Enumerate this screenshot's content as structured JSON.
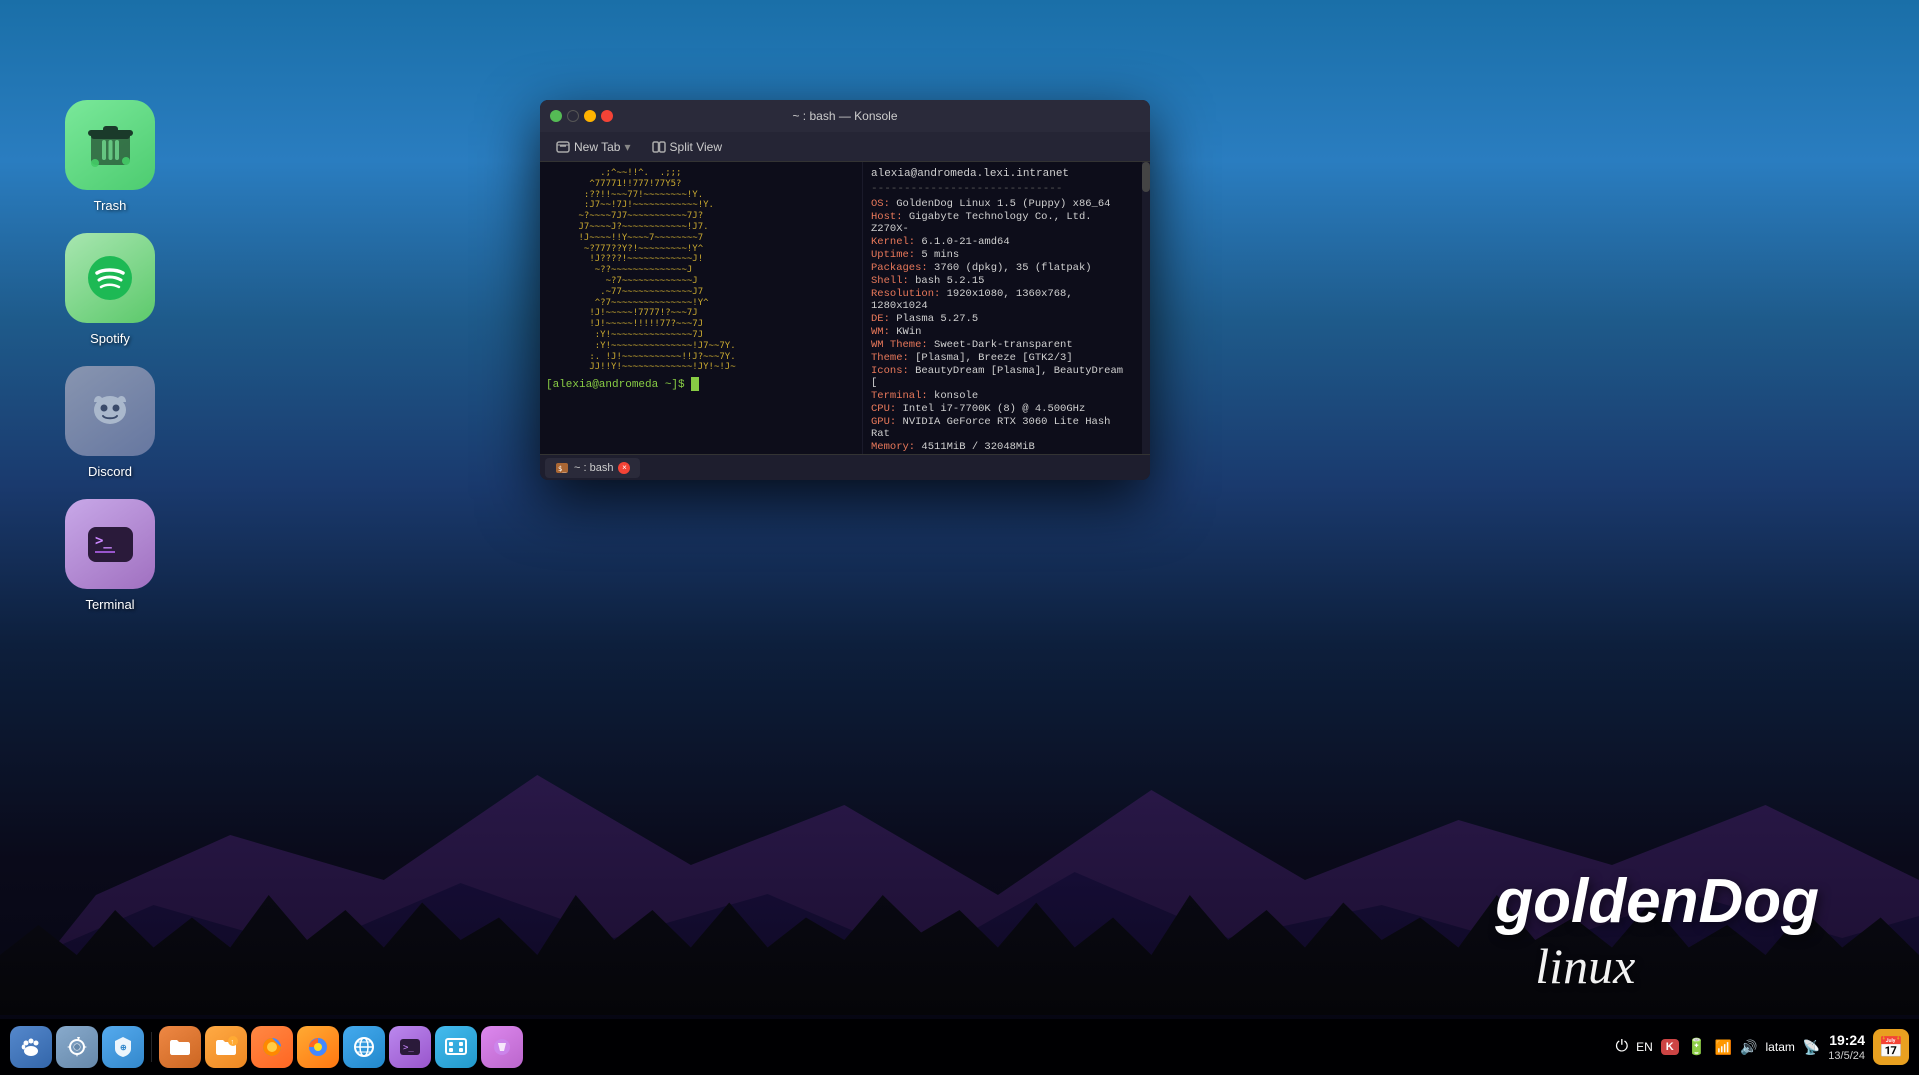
{
  "desktop": {
    "background": "KDE Plasma desktop - GoldenDog Linux",
    "icons": [
      {
        "id": "trash",
        "label": "Trash",
        "color": "#4dcc70"
      },
      {
        "id": "spotify",
        "label": "Spotify",
        "color": "#5cc96b"
      },
      {
        "id": "discord",
        "label": "Discord",
        "color": "#8895b0"
      },
      {
        "id": "terminal",
        "label": "Terminal",
        "color": "#a070c0"
      }
    ]
  },
  "logo": {
    "line1": "goldenDog",
    "line2": "linux"
  },
  "konsole": {
    "title": "~ : bash — Konsole",
    "toolbar": {
      "new_tab": "New Tab",
      "split_view": "Split View"
    },
    "ascii_art": "          .;^~~!!^.  .;;;\n        ^77771!!777!77Y5?\n       :??!!~~~77!~~~~~~~~!Y.\n       :J7~~!7J!~~~~~~~~~~~~!Y.\n      ~?~~~~7J7~~~~~~~~~~~7J?\n      J7~~~~J?~~~~~~~~~~~~!J7.\n      !J~~~~!!Y~~~~7~~~~~~~~7\n       ~?777??Y?!~~~~~~~~~!Y^\n        !J????!~~~~~~~~~~~~J!\n         ~??~~~~~~~~~~~~~~J\n           ~?7~~~~~~~~~~~~~J\n          .~77~~~~~~~~~~~~~J7\n         ^?7~~~~~~~~~~~~~~~!Y^\n        !J!~~~~~!7777!?~~~7J\n        !J!~~~~~!!!!!77?~~~7J\n         :Y!~~~~~~~~~~~~~~~7J\n         :Y!~~~~~~~~~~~~~~~!J7~~7Y.\n        :. !J!~~~~~~~~~~~!!J?~~~7Y.\n        JJ!!Y!~~~~~~~~~~~~~!JY!~!J~",
    "prompt": "[alexia@andromeda ~]$",
    "sysinfo": {
      "user_host": "alexia@andromeda.lexi.intranet",
      "divider": "-----------------------------",
      "fields": [
        {
          "key": "OS:",
          "value": "GoldenDog Linux 1.5 (Puppy) x86_64"
        },
        {
          "key": "Host:",
          "value": "Gigabyte Technology Co., Ltd. Z270X-"
        },
        {
          "key": "Kernel:",
          "value": "6.1.0-21-amd64"
        },
        {
          "key": "Uptime:",
          "value": "5 mins"
        },
        {
          "key": "Packages:",
          "value": "3760 (dpkg), 35 (flatpak)"
        },
        {
          "key": "Shell:",
          "value": "bash 5.2.15"
        },
        {
          "key": "Resolution:",
          "value": "1920x1080, 1360x768, 1280x1024"
        },
        {
          "key": "DE:",
          "value": "Plasma 5.27.5"
        },
        {
          "key": "WM:",
          "value": "KWin"
        },
        {
          "key": "WM Theme:",
          "value": "Sweet-Dark-transparent"
        },
        {
          "key": "Theme:",
          "value": "[Plasma], Breeze [GTK2/3]"
        },
        {
          "key": "Icons:",
          "value": "BeautyDream [Plasma], BeautyDream ["
        },
        {
          "key": "Terminal:",
          "value": "konsole"
        },
        {
          "key": "CPU:",
          "value": "Intel i7-7700K (8) @ 4.500GHz"
        },
        {
          "key": "GPU:",
          "value": "NVIDIA GeForce RTX 3060 Lite Hash Rat"
        },
        {
          "key": "Memory:",
          "value": "4511MiB / 32048MiB"
        }
      ],
      "color_blocks": [
        "#555555",
        "#cc4444",
        "#44cc44",
        "#cccc44",
        "#4444cc",
        "#cc44cc",
        "#44cccc",
        "#cccccc",
        "#333333",
        "#ff6666",
        "#66ff66",
        "#ffff66",
        "#6666ff",
        "#ff66ff",
        "#66ffff",
        "#ffffff"
      ]
    },
    "tab": {
      "label": "~ : bash",
      "icon": "terminal"
    }
  },
  "taskbar": {
    "icons": [
      {
        "id": "paw",
        "symbol": "🐾",
        "bg": "tb-paw"
      },
      {
        "id": "gear",
        "symbol": "⚙",
        "bg": "tb-gear"
      },
      {
        "id": "shield",
        "symbol": "🛡",
        "bg": "tb-shield"
      },
      {
        "id": "folder-red",
        "symbol": "📁",
        "bg": "tb-folder-red"
      },
      {
        "id": "folder-orange",
        "symbol": "📂",
        "bg": "tb-folder-orange"
      },
      {
        "id": "firefox",
        "symbol": "🦊",
        "bg": "tb-firefox"
      },
      {
        "id": "firefox2",
        "symbol": "🔥",
        "bg": "tb-firefox2"
      },
      {
        "id": "globe",
        "symbol": "🌐",
        "bg": "tb-globe"
      },
      {
        "id": "terminal",
        "symbol": "⌨",
        "bg": "tb-term"
      },
      {
        "id": "screen",
        "symbol": "🖥",
        "bg": "tb-screen"
      },
      {
        "id": "plasma",
        "symbol": "✨",
        "bg": "tb-plasma"
      }
    ],
    "system_tray": {
      "power": "⏻",
      "lang": "EN",
      "k_icon": "K",
      "battery": "🔋",
      "bluetooth": "📶",
      "volume": "🔊",
      "network": "latam",
      "wifi": "📡"
    },
    "clock": {
      "time": "19:24",
      "date": "13/5/24"
    }
  }
}
